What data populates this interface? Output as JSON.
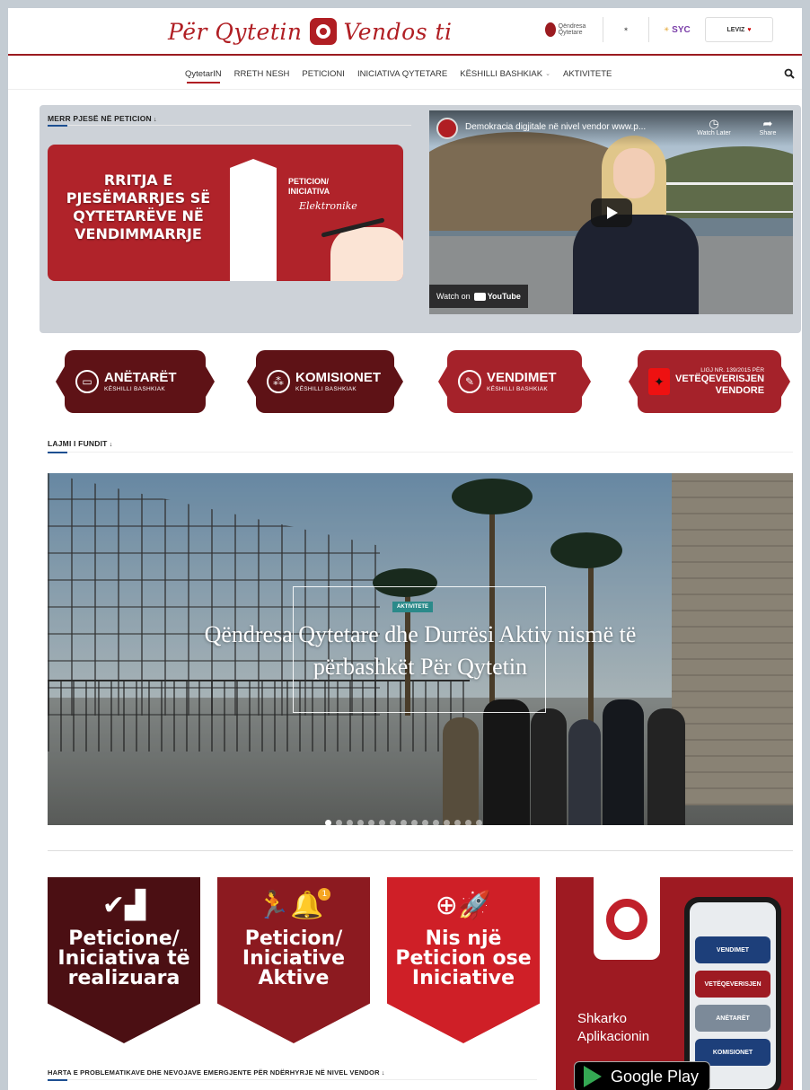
{
  "header": {
    "logo_left": "Për Qytetin",
    "logo_right": "Vendos ti",
    "partners": [
      "Qëndresa Qytetare",
      "",
      "SYC",
      "LEVIZ"
    ]
  },
  "nav": {
    "items": [
      "QytetarIN",
      "RRETH NESH",
      "PETICIONI",
      "INICIATIVA QYTETARE",
      "KËSHILLI BASHKIAK",
      "AKTIVITETE"
    ],
    "active_index": 0
  },
  "petition": {
    "section_title": "MERR PJESË NË PETICION",
    "banner_text": "RRITJA E PJESËMARRJES SË QYTETARËVE NË VENDIMMARRJE",
    "banner_label": "PETICION/ INICIATIVA",
    "banner_sub": "Elektronike"
  },
  "video": {
    "title": "Demokracia digjitale në nivel vendor www.p...",
    "watch_later": "Watch Later",
    "share": "Share",
    "watch_on": "Watch on",
    "youtube": "YouTube"
  },
  "info_buttons": [
    {
      "title": "ANËTARËT",
      "sub": "KËSHILLI BASHKIAK",
      "icon": "id-card-icon"
    },
    {
      "title": "KOMISIONET",
      "sub": "KËSHILLI BASHKIAK",
      "icon": "network-icon"
    },
    {
      "title": "VENDIMET",
      "sub": "KËSHILLI BASHKIAK",
      "icon": "document-check-icon"
    },
    {
      "line1": "LIGJ NR. 139/2015 PËR",
      "line2": "VETËQEVERISJEN",
      "line3": "VENDORE",
      "icon": "albania-flag-icon"
    }
  ],
  "news": {
    "section_title": "LAJMI I FUNDIT",
    "tag": "AKTIVITETE",
    "headline": "Qëndresa Qytetare dhe Durrësi Aktiv nismë të përbashkët Për Qytetin",
    "dot_count": 15,
    "active_dot": 0
  },
  "shields": [
    {
      "text": "Peticione/ Iniciativa të realizuara",
      "icon": "check-podium-icon"
    },
    {
      "text": "Peticion/ Iniciative Aktive",
      "icon": "runner-bell-icon",
      "badge": "1"
    },
    {
      "text": "Nis një Peticion ose Iniciative",
      "icon": "plus-rocket-icon"
    }
  ],
  "app": {
    "line1": "Shkarko",
    "line2": "Aplikacionin",
    "store": "Google Play",
    "phone_items": [
      "VENDIMET",
      "VETËQEVERISJEN",
      "ANËTARËT",
      "KOMISIONET"
    ]
  },
  "map": {
    "section_title": "HARTA E PROBLEMATIKAVE DHE NEVOJAVE EMERGJENTE PËR NDËRHYRJE NË NIVEL VENDOR"
  },
  "colors": {
    "brand_red": "#b01e23",
    "dark_red": "#5e1216",
    "accent_blue": "#1d4f91",
    "tag_teal": "#2b8a8a"
  }
}
